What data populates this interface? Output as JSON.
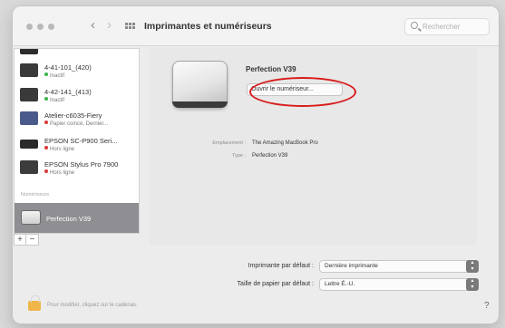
{
  "window": {
    "title": "Imprimantes et numériseurs",
    "search_placeholder": "Rechercher",
    "nav": {
      "back": "‹",
      "forward": "›"
    }
  },
  "printers": [
    {
      "name": "",
      "status": "",
      "icon_color": "#2c2c2c",
      "dot_color": "#3bb44a"
    },
    {
      "name": "4-41-101_(420)",
      "status": "Inactif",
      "icon_color": "#3a3a3a",
      "dot_color": "#3bb44a"
    },
    {
      "name": "4-42-141_(413)",
      "status": "Inactif",
      "icon_color": "#3a3a3a",
      "dot_color": "#3bb44a"
    },
    {
      "name": "Atelier-c6035-Fiery",
      "status": "Papier coincé, Dernier...",
      "icon_color": "#4a5a8a",
      "dot_color": "#d93a3a"
    },
    {
      "name": "EPSON SC-P900 Seri...",
      "status": "Hors ligne",
      "icon_color": "#2a2a2a",
      "dot_color": "#d93a3a"
    },
    {
      "name": "EPSON Stylus Pro 7900",
      "status": "Hors ligne",
      "icon_color": "#3c3c3c",
      "dot_color": "#d93a3a"
    }
  ],
  "scanners_section": "Numériseurs",
  "selected": {
    "name": "Perfection V39"
  },
  "list_buttons": {
    "add": "+",
    "remove": "−"
  },
  "detail": {
    "device_name": "Perfection V39",
    "open_button": "Ouvrir le numériseur...",
    "info": [
      {
        "label": "Emplacement :",
        "value": "The Amazing MacBook Pro"
      },
      {
        "label": "Type :",
        "value": "Perfection V39"
      }
    ]
  },
  "defaults": {
    "printer_label": "Imprimante par défaut :",
    "printer_value": "Dernière imprimante",
    "paper_label": "Taille de papier par défaut :",
    "paper_value": "Lettre É.-U."
  },
  "footer": {
    "lock_text": "Pour modifier, cliquez sur le cadenas.",
    "help": "?"
  },
  "colors": {
    "selection": "#8e8e93",
    "annotation": "#d91c1c",
    "lock": "#f0b64a"
  }
}
